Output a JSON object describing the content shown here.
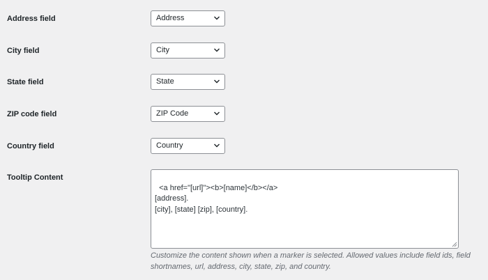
{
  "fields": [
    {
      "label": "Address field",
      "value": "Address"
    },
    {
      "label": "City field",
      "value": "City"
    },
    {
      "label": "State field",
      "value": "State"
    },
    {
      "label": "ZIP code field",
      "value": "ZIP Code"
    },
    {
      "label": "Country field",
      "value": "Country"
    }
  ],
  "tooltip": {
    "label": "Tooltip Content",
    "content": "<a href=\"[url]\"><b>[name]</b></a>\n[address].\n[city], [state] [zip], [country].",
    "description": "Customize the content shown when a marker is selected. Allowed values include field ids, field shortnames, url, address, city, state, zip, and country."
  },
  "icons": {
    "select_chevron": "chevron-down-icon",
    "textarea_grip": "resize-grip-icon"
  },
  "colors": {
    "background": "#f0f0f1",
    "text": "#1d2327",
    "border": "#8c8f94",
    "description": "#646970"
  }
}
